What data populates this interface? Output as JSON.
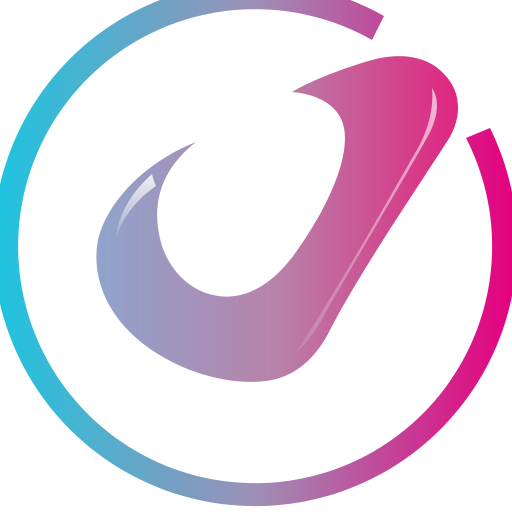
{
  "logo": {
    "icon": "checkmark-in-ring-icon",
    "colors": {
      "gradient_start": "#1FC3DF",
      "gradient_mid": "#9E8FB5",
      "gradient_end": "#E5007E",
      "background": "#FFFFFF",
      "highlight": "#FFFFFF"
    }
  }
}
